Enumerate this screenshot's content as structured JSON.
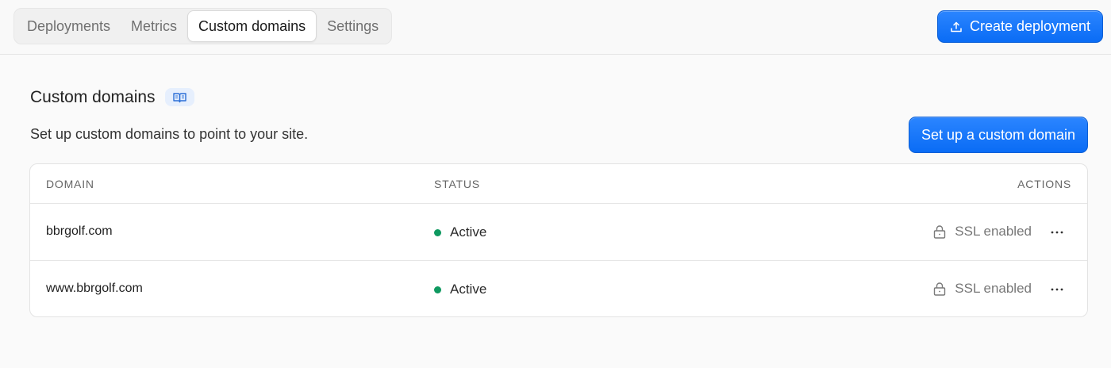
{
  "tabs": [
    {
      "label": "Deployments",
      "active": false
    },
    {
      "label": "Metrics",
      "active": false
    },
    {
      "label": "Custom domains",
      "active": true
    },
    {
      "label": "Settings",
      "active": false
    }
  ],
  "header": {
    "create_label": "Create deployment",
    "create_icon": "upload-icon"
  },
  "section": {
    "title": "Custom domains",
    "docs_icon": "book-icon",
    "subtitle": "Set up custom domains to point to your site.",
    "setup_label": "Set up a custom domain"
  },
  "table": {
    "columns": [
      "DOMAIN",
      "STATUS",
      "ACTIONS"
    ],
    "rows": [
      {
        "domain": "bbrgolf.com",
        "status": "Active",
        "ssl": "SSL enabled"
      },
      {
        "domain": "www.bbrgolf.com",
        "status": "Active",
        "ssl": "SSL enabled"
      }
    ]
  },
  "colors": {
    "accent": "#0a6cf5",
    "status_active": "#0f9960",
    "docs_badge_bg": "#e6effd"
  }
}
